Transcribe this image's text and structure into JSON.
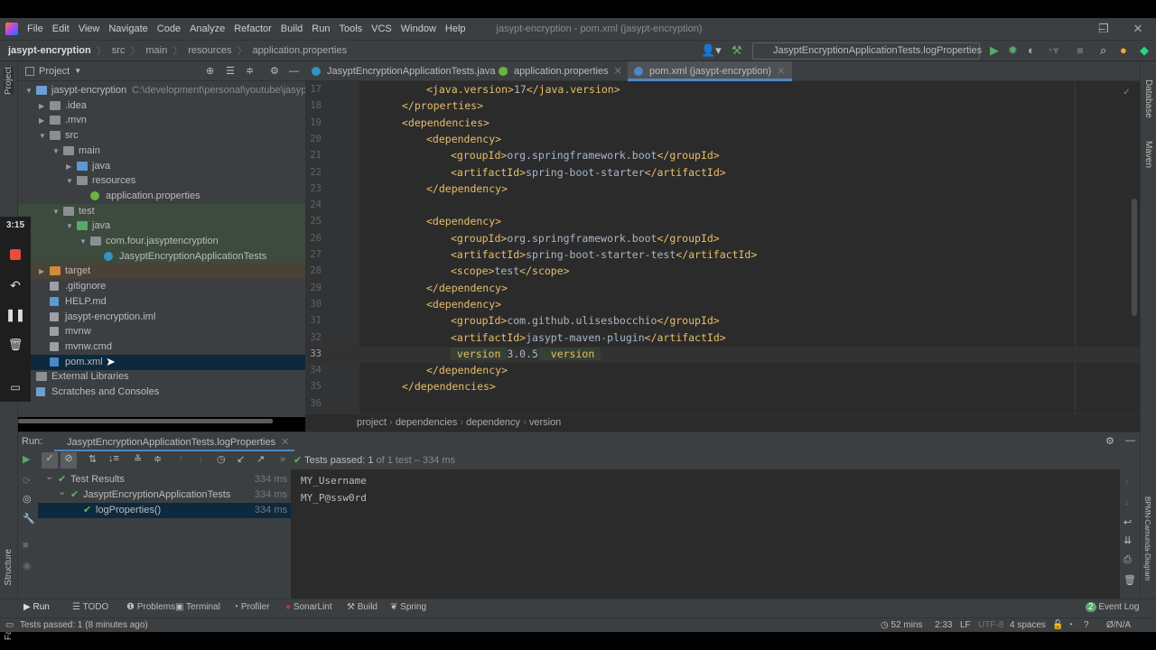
{
  "window": {
    "title": "jasypt-encryption - pom.xml (jasypt-encryption)"
  },
  "menu": [
    "File",
    "Edit",
    "View",
    "Navigate",
    "Code",
    "Analyze",
    "Refactor",
    "Build",
    "Run",
    "Tools",
    "VCS",
    "Window",
    "Help"
  ],
  "navbar": {
    "crumbs": [
      "jasypt-encryption",
      "src",
      "main",
      "resources",
      "application.properties"
    ],
    "run_config": "JasyptEncryptionApplicationTests.logProperties"
  },
  "project": {
    "title": "Project",
    "vertical_label": "Project",
    "tree": [
      {
        "level": 0,
        "arrow": "open",
        "icon": "module",
        "label": "jasypt-encryption",
        "hint": "C:\\development\\personal\\youtube\\jasypt-en"
      },
      {
        "level": 1,
        "arrow": "closed",
        "icon": "folder",
        "label": ".idea"
      },
      {
        "level": 1,
        "arrow": "closed",
        "icon": "folder",
        "label": ".mvn"
      },
      {
        "level": 1,
        "arrow": "open",
        "icon": "folder",
        "label": "src"
      },
      {
        "level": 2,
        "arrow": "open",
        "icon": "folder",
        "label": "main"
      },
      {
        "level": 3,
        "arrow": "closed",
        "icon": "src",
        "label": "java"
      },
      {
        "level": 3,
        "arrow": "open",
        "icon": "res",
        "label": "resources"
      },
      {
        "level": 4,
        "arrow": "none",
        "icon": "spring",
        "label": "application.properties"
      },
      {
        "level": 2,
        "arrow": "open",
        "icon": "folder",
        "label": "test",
        "state": "test"
      },
      {
        "level": 3,
        "arrow": "open",
        "icon": "test",
        "label": "java",
        "state": "test"
      },
      {
        "level": 4,
        "arrow": "open",
        "icon": "package",
        "label": "com.four.jasyptencryption",
        "state": "test"
      },
      {
        "level": 5,
        "arrow": "none",
        "icon": "class",
        "label": "JasyptEncryptionApplicationTests",
        "state": "test"
      },
      {
        "level": 1,
        "arrow": "closed",
        "icon": "target",
        "label": "target",
        "state": "excluded"
      },
      {
        "level": 1,
        "arrow": "none",
        "icon": "file",
        "label": ".gitignore"
      },
      {
        "level": 1,
        "arrow": "none",
        "icon": "md",
        "label": "HELP.md"
      },
      {
        "level": 1,
        "arrow": "none",
        "icon": "file",
        "label": "jasypt-encryption.iml"
      },
      {
        "level": 1,
        "arrow": "none",
        "icon": "file",
        "label": "mvnw"
      },
      {
        "level": 1,
        "arrow": "none",
        "icon": "file",
        "label": "mvnw.cmd"
      },
      {
        "level": 1,
        "arrow": "none",
        "icon": "maven",
        "label": "pom.xml",
        "state": "selected"
      },
      {
        "level": 0,
        "arrow": "closed",
        "icon": "lib",
        "label": "External Libraries"
      },
      {
        "level": 0,
        "arrow": "none",
        "icon": "scratch",
        "label": "Scratches and Consoles"
      }
    ]
  },
  "tabs": [
    {
      "label": "JasyptEncryptionApplicationTests.java",
      "icon": "class"
    },
    {
      "label": "application.properties",
      "icon": "spring"
    },
    {
      "label": "pom.xml (jasypt-encryption)",
      "icon": "maven",
      "active": true
    }
  ],
  "editor": {
    "current_line": 33,
    "lines": [
      {
        "n": 17,
        "i": 2,
        "t": [
          [
            "tag",
            "<java.version>"
          ],
          [
            "txt",
            "17"
          ],
          [
            "tag",
            "</java.version>"
          ]
        ]
      },
      {
        "n": 18,
        "i": 1,
        "t": [
          [
            "tag",
            "</properties>"
          ]
        ]
      },
      {
        "n": 19,
        "i": 1,
        "t": [
          [
            "tag",
            "<dependencies>"
          ]
        ]
      },
      {
        "n": 20,
        "i": 2,
        "t": [
          [
            "tag",
            "<dependency>"
          ]
        ]
      },
      {
        "n": 21,
        "i": 3,
        "t": [
          [
            "tag",
            "<groupId>"
          ],
          [
            "txt",
            "org.springframework.boot"
          ],
          [
            "tag",
            "</groupId>"
          ]
        ]
      },
      {
        "n": 22,
        "i": 3,
        "t": [
          [
            "tag",
            "<artifactId>"
          ],
          [
            "txt",
            "spring-boot-starter"
          ],
          [
            "tag",
            "</artifactId>"
          ]
        ]
      },
      {
        "n": 23,
        "i": 2,
        "t": [
          [
            "tag",
            "</dependency>"
          ]
        ]
      },
      {
        "n": 24,
        "i": 0,
        "t": []
      },
      {
        "n": 25,
        "i": 2,
        "t": [
          [
            "tag",
            "<dependency>"
          ]
        ]
      },
      {
        "n": 26,
        "i": 3,
        "t": [
          [
            "tag",
            "<groupId>"
          ],
          [
            "txt",
            "org.springframework.boot"
          ],
          [
            "tag",
            "</groupId>"
          ]
        ]
      },
      {
        "n": 27,
        "i": 3,
        "t": [
          [
            "tag",
            "<artifactId>"
          ],
          [
            "txt",
            "spring-boot-starter-test"
          ],
          [
            "tag",
            "</artifactId>"
          ]
        ]
      },
      {
        "n": 28,
        "i": 3,
        "t": [
          [
            "tag",
            "<scope>"
          ],
          [
            "txt",
            "test"
          ],
          [
            "tag",
            "</scope>"
          ]
        ]
      },
      {
        "n": 29,
        "i": 2,
        "t": [
          [
            "tag",
            "</dependency>"
          ]
        ]
      },
      {
        "n": 30,
        "i": 2,
        "t": [
          [
            "tag",
            "<dependency>"
          ]
        ]
      },
      {
        "n": 31,
        "i": 3,
        "t": [
          [
            "tag",
            "<groupId>"
          ],
          [
            "txt",
            "com.github.ulisesbocchio"
          ],
          [
            "tag",
            "</groupId>"
          ]
        ]
      },
      {
        "n": 32,
        "i": 3,
        "t": [
          [
            "tag",
            "<artifactId>"
          ],
          [
            "txt",
            "jasypt-maven-plugin"
          ],
          [
            "tag",
            "</artifactId>"
          ]
        ]
      },
      {
        "n": 33,
        "i": 3,
        "t": [
          [
            "tag",
            " version "
          ],
          [
            "txt",
            "3.0.5"
          ],
          [
            "tag",
            "  version "
          ]
        ]
      },
      {
        "n": 34,
        "i": 2,
        "t": [
          [
            "tag",
            "</dependency>"
          ]
        ]
      },
      {
        "n": 35,
        "i": 1,
        "t": [
          [
            "tag",
            "</dependencies>"
          ]
        ]
      },
      {
        "n": 36,
        "i": 0,
        "t": []
      }
    ]
  },
  "breadcrumb": [
    "project",
    "dependencies",
    "dependency",
    "version"
  ],
  "run": {
    "label": "Run:",
    "tab": "JasyptEncryptionApplicationTests.logProperties",
    "status_prefix": "Tests passed:",
    "passed": "1",
    "status_suffix": "of 1 test – 334 ms",
    "results": [
      {
        "label": "Test Results",
        "time": "334 ms",
        "level": 0
      },
      {
        "label": "JasyptEncryptionApplicationTests",
        "time": "334 ms",
        "level": 1
      },
      {
        "label": "logProperties()",
        "time": "334 ms",
        "level": 2,
        "selected": true
      }
    ],
    "console": [
      "MY_Username",
      "MY_P@ssw0rd"
    ]
  },
  "bottom_tabs": [
    "Run",
    "TODO",
    "Problems",
    "Terminal",
    "Profiler",
    "SonarLint",
    "Build",
    "Spring"
  ],
  "event_log": {
    "label": "Event Log",
    "count": "2"
  },
  "status": {
    "message": "Tests passed: 1 (8 minutes ago)",
    "time": "52 mins",
    "position": "2:33",
    "line_sep": "LF",
    "encoding": "UTF-8",
    "indent": "4 spaces",
    "vcs": "Ø/N/A"
  },
  "side_labels": {
    "structure": "Structure",
    "favorites": "Favorites",
    "database": "Database",
    "maven": "Maven",
    "bpmn": "BPMN-Camunda-Diagram"
  },
  "recorder": {
    "time": "3:15"
  }
}
